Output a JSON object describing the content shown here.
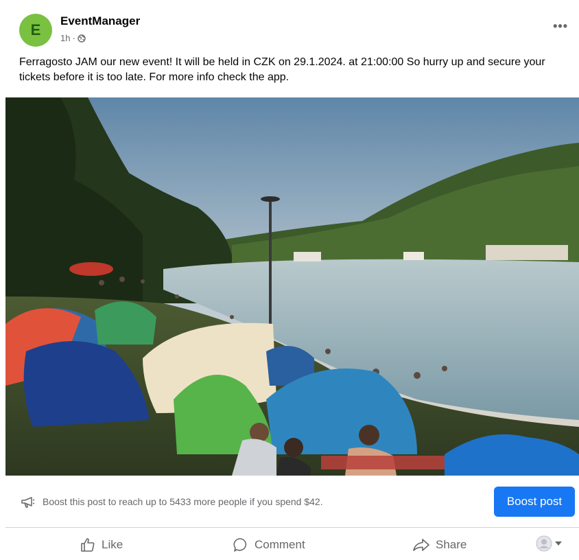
{
  "post": {
    "author": "EventManager",
    "avatar_letter": "E",
    "time": "1h",
    "separator": "·",
    "more_label": "•••",
    "text": "Ferragosto JAM our new event! It will be held in CZK on 29.1.2024. at 21:00:00 So hurry up and secure your tickets before it is too late. For more info check the app."
  },
  "boost": {
    "text": "Boost this post to reach up to 5433 more people if you spend $42.",
    "button_label": "Boost post"
  },
  "actions": {
    "like": "Like",
    "comment": "Comment",
    "share": "Share"
  },
  "colors": {
    "accent": "#1877f2",
    "avatar_bg": "#7ac142",
    "secondary_text": "#65676b"
  }
}
